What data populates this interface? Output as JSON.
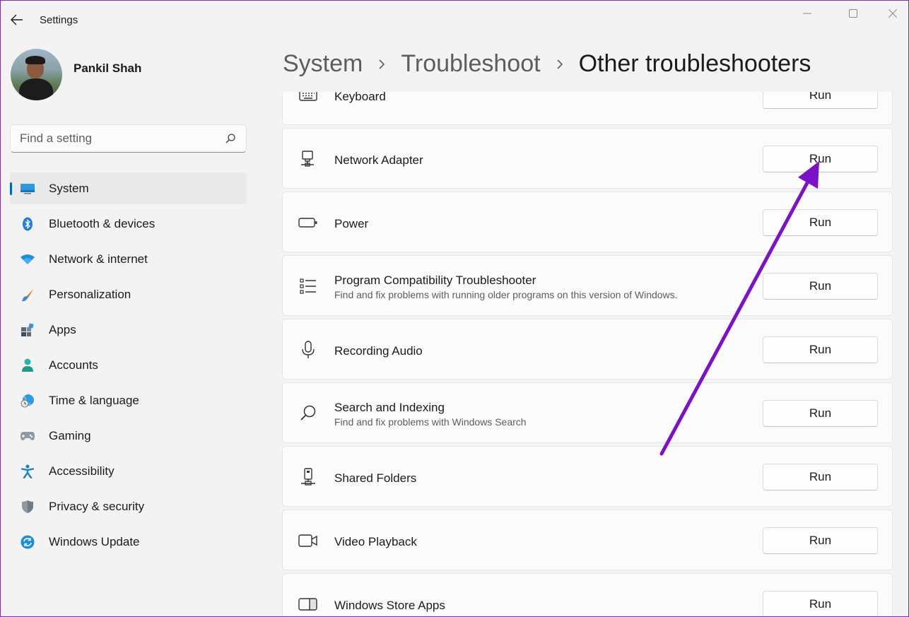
{
  "window": {
    "title": "Settings"
  },
  "profile": {
    "name": "Pankil Shah"
  },
  "search": {
    "placeholder": "Find a setting"
  },
  "sidebar": {
    "items": [
      {
        "label": "System",
        "icon": "system-icon",
        "active": true
      },
      {
        "label": "Bluetooth & devices",
        "icon": "bluetooth-icon"
      },
      {
        "label": "Network & internet",
        "icon": "wifi-icon"
      },
      {
        "label": "Personalization",
        "icon": "brush-icon"
      },
      {
        "label": "Apps",
        "icon": "apps-icon"
      },
      {
        "label": "Accounts",
        "icon": "person-icon"
      },
      {
        "label": "Time & language",
        "icon": "globe-clock-icon"
      },
      {
        "label": "Gaming",
        "icon": "gamepad-icon"
      },
      {
        "label": "Accessibility",
        "icon": "accessibility-icon"
      },
      {
        "label": "Privacy & security",
        "icon": "shield-icon"
      },
      {
        "label": "Windows Update",
        "icon": "update-icon"
      }
    ]
  },
  "breadcrumb": {
    "items": [
      "System",
      "Troubleshoot",
      "Other troubleshooters"
    ]
  },
  "troubleshooters": [
    {
      "title": "Keyboard",
      "icon": "keyboard-icon",
      "button": "Run"
    },
    {
      "title": "Network Adapter",
      "icon": "network-adapter-icon",
      "button": "Run"
    },
    {
      "title": "Power",
      "icon": "battery-icon",
      "button": "Run"
    },
    {
      "title": "Program Compatibility Troubleshooter",
      "description": "Find and fix problems with running older programs on this version of Windows.",
      "icon": "list-icon",
      "button": "Run"
    },
    {
      "title": "Recording Audio",
      "icon": "microphone-icon",
      "button": "Run"
    },
    {
      "title": "Search and Indexing",
      "description": "Find and fix problems with Windows Search",
      "icon": "search-icon",
      "button": "Run"
    },
    {
      "title": "Shared Folders",
      "icon": "shared-folder-icon",
      "button": "Run"
    },
    {
      "title": "Video Playback",
      "icon": "video-camera-icon",
      "button": "Run"
    },
    {
      "title": "Windows Store Apps",
      "icon": "store-app-icon",
      "button": "Run"
    }
  ],
  "annotation": {
    "arrow_color": "#7b12c9"
  },
  "colors": {
    "accent": "#0067c0",
    "background": "#f3f3f3",
    "card": "#fbfbfb"
  }
}
